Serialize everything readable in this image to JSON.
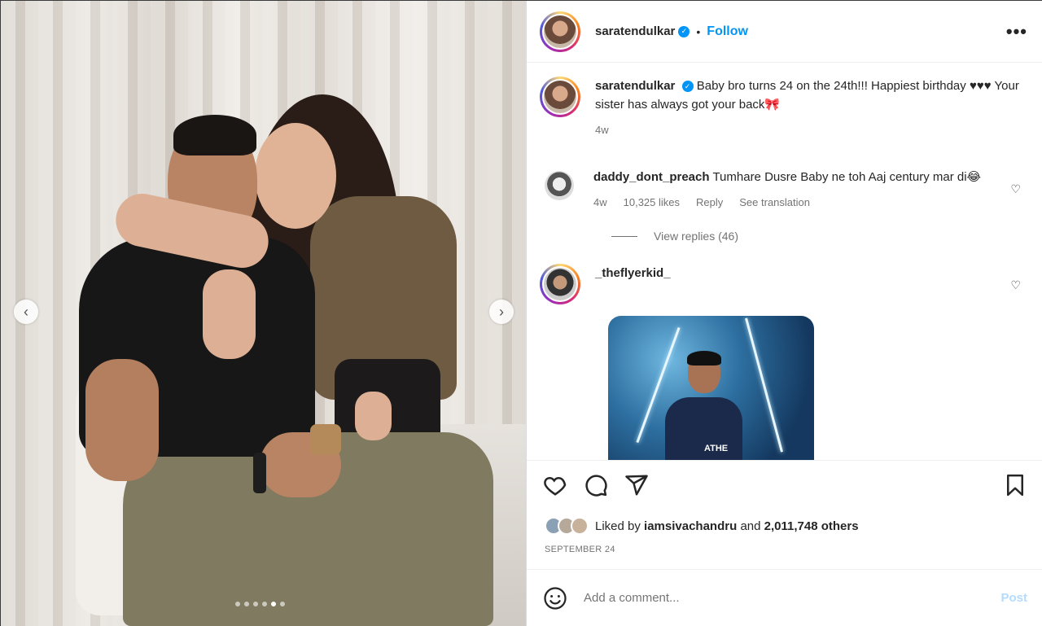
{
  "post": {
    "username": "saratendulkar",
    "verified": true,
    "separator": "•",
    "follow_label": "Follow",
    "more_label": "•••",
    "carousel": {
      "prev": "‹",
      "next": "›",
      "slide_count": 6,
      "active_index": 4
    }
  },
  "caption": {
    "username": "saratendulkar",
    "text": "Baby bro turns 24 on the 24th!!! Happiest birthday ♥♥♥ Your sister has always got your back🎀",
    "time": "4w"
  },
  "comments": [
    {
      "username": "daddy_dont_preach",
      "text": "Tumhare Dusre Baby ne toh Aaj century mar di😂",
      "time": "4w",
      "likes": "10,325 likes",
      "reply": "Reply",
      "translation": "See translation",
      "view_replies": "View replies (46)"
    },
    {
      "username": "_theflyerkid_",
      "gif_text": "ATHE"
    }
  ],
  "actions": {
    "like_icon": "heart-icon",
    "comment_icon": "comment-icon",
    "share_icon": "share-icon",
    "save_icon": "bookmark-icon"
  },
  "likes": {
    "prefix": "Liked by",
    "user": "iamsivachandru",
    "middle": "and",
    "others": "2,011,748 others"
  },
  "date": "SEPTEMBER 24",
  "add_comment": {
    "placeholder": "Add a comment...",
    "post_label": "Post"
  },
  "colors": {
    "accent": "#0095f6",
    "post_disabled": "#b3dbff",
    "muted": "#737373"
  }
}
